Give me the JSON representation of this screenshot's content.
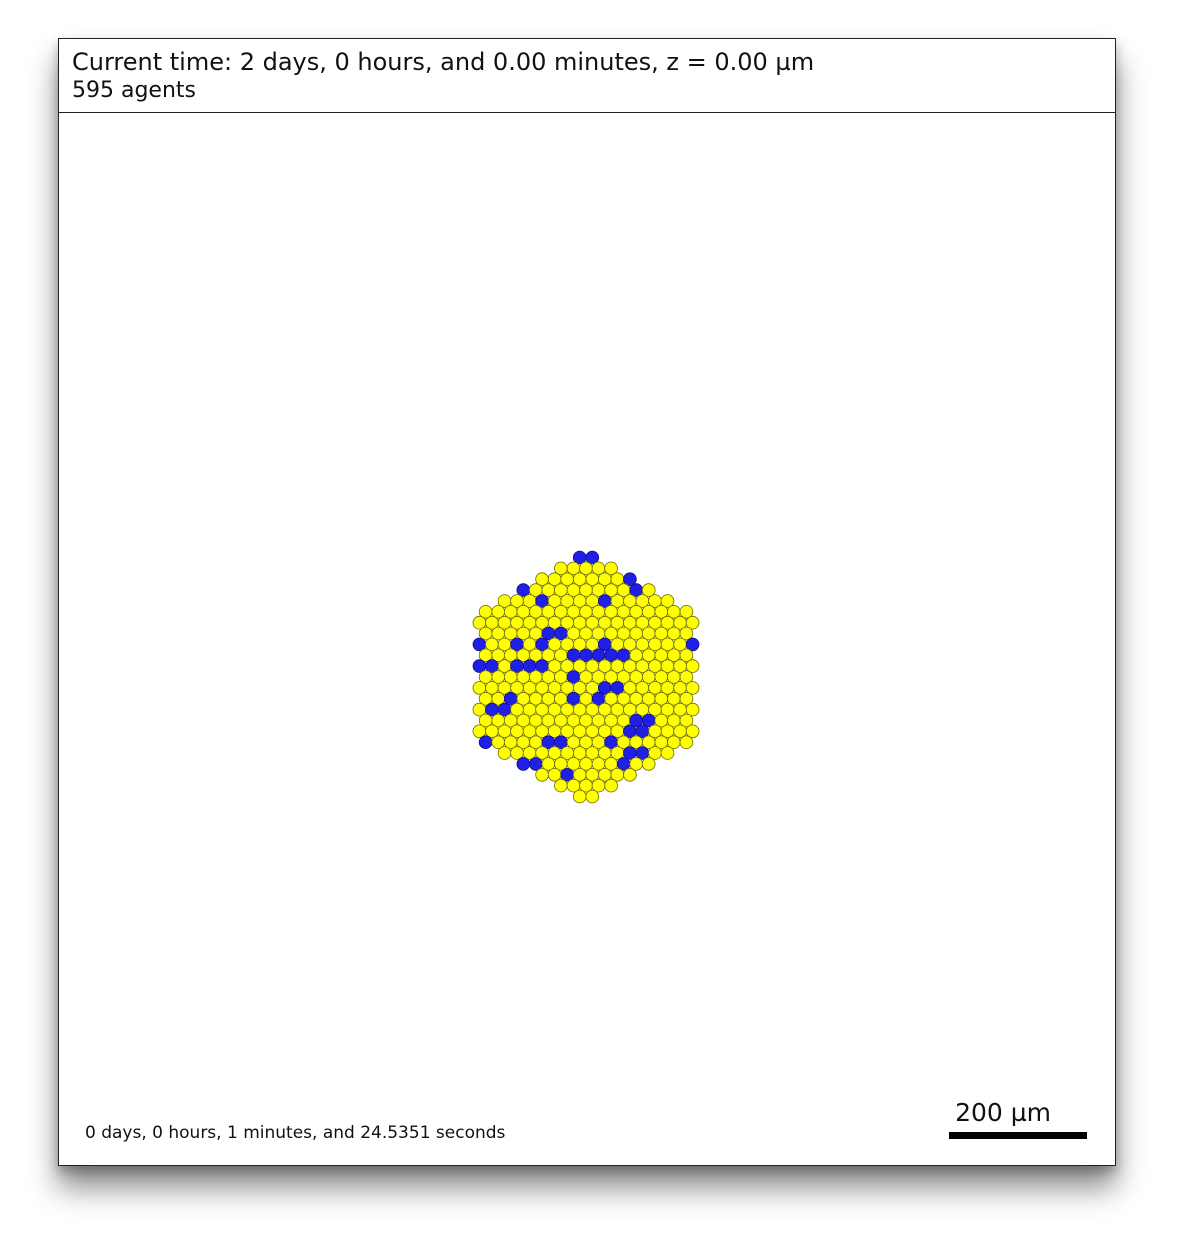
{
  "header": {
    "time_text": "Current time: 2 days, 0 hours, and 0.00 minutes, z = 0.00 µm",
    "agents_text": "595 agents"
  },
  "footer": {
    "runtime_text": "0 days, 0 hours, 1 minutes, and 24.5351 seconds",
    "scale_label": "200 µm"
  },
  "agents": {
    "count": 595,
    "colors": {
      "primary": "#ffff00",
      "secondary": "#1f1fe6",
      "outline": "#6b6b00",
      "outline_secondary": "#101080"
    }
  }
}
